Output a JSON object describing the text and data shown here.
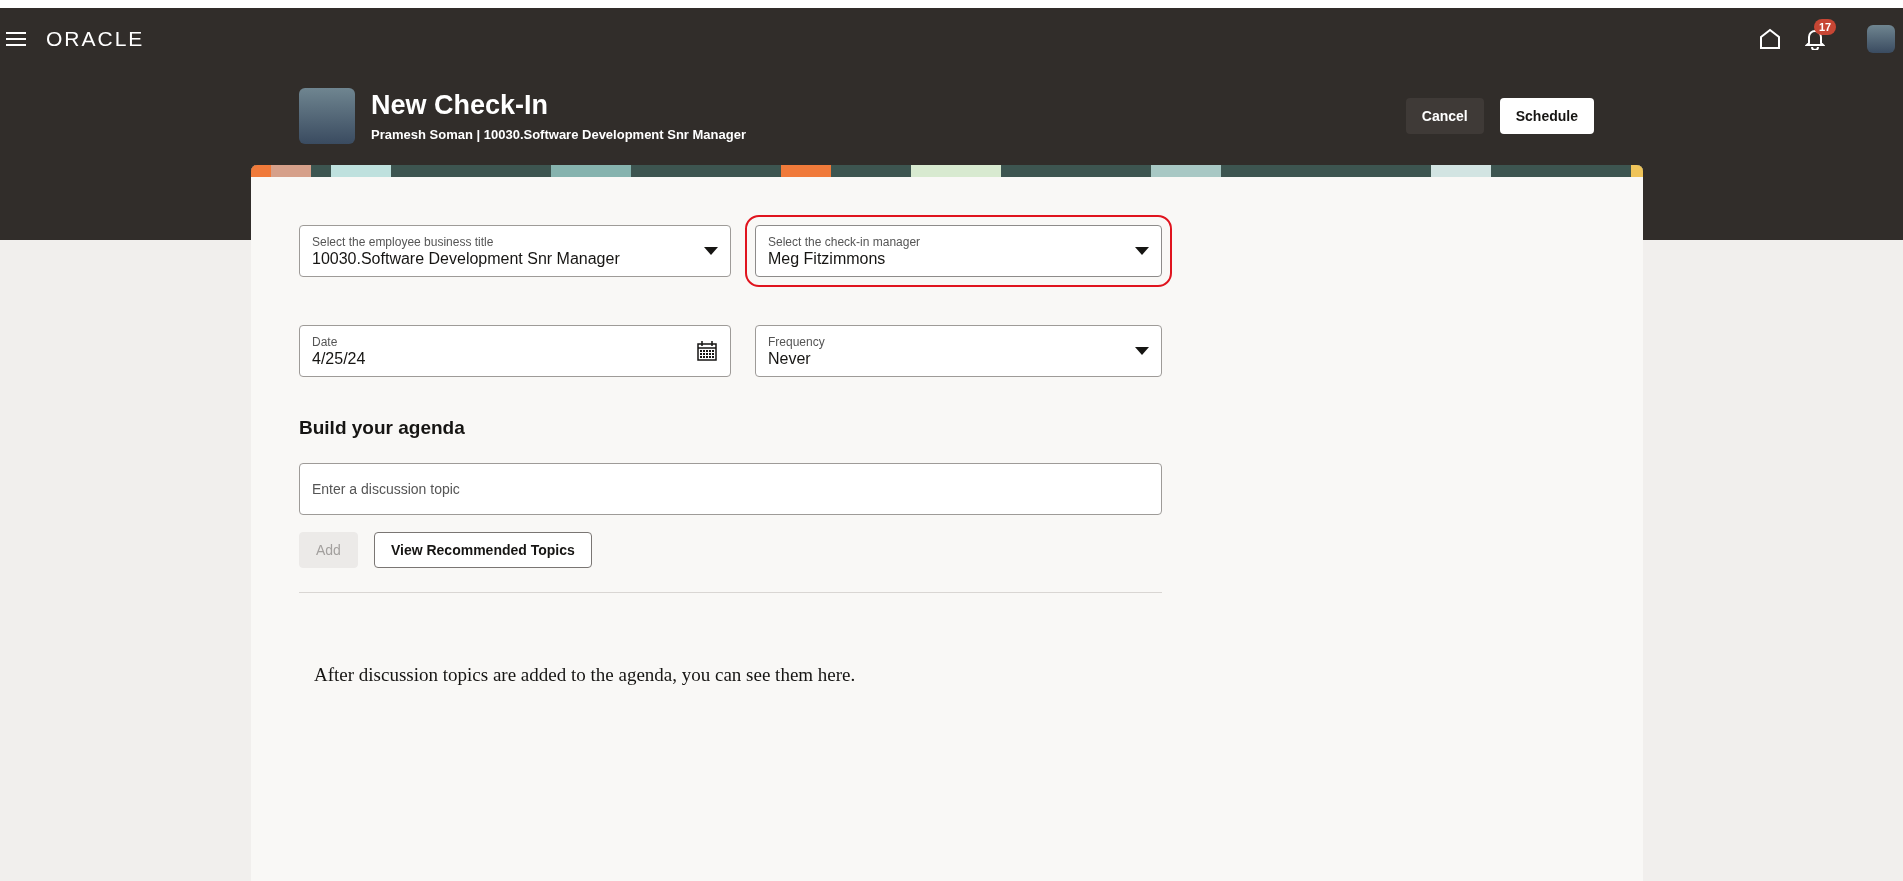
{
  "header": {
    "logo": "ORACLE",
    "notification_count": "17"
  },
  "page": {
    "title": "New Check-In",
    "subtitle": "Pramesh Soman | 10030.Software Development Snr Manager",
    "actions": [
      {
        "label": "Cancel",
        "kind": "secondary"
      },
      {
        "label": "Schedule",
        "kind": "primary"
      }
    ]
  },
  "fields": [
    {
      "kind": "select",
      "label": "Select the employee business title",
      "value": "10030.Software Development Snr Manager",
      "highlighted": false
    },
    {
      "kind": "select",
      "label": "Select the check-in manager",
      "value": "Meg Fitzimmons",
      "highlighted": true
    },
    {
      "kind": "date",
      "label": "Date",
      "value": "4/25/24",
      "highlighted": false
    },
    {
      "kind": "select",
      "label": "Frequency",
      "value": "Never",
      "highlighted": false
    }
  ],
  "agenda": {
    "title": "Build your agenda",
    "topic": {
      "placeholder": "Enter a discussion topic"
    },
    "buttons": [
      {
        "label": "Add",
        "disabled": true
      },
      {
        "label": "View Recommended Topics",
        "disabled": false
      }
    ],
    "empty_message": "After discussion topics are added to the agenda, you can see them here."
  }
}
